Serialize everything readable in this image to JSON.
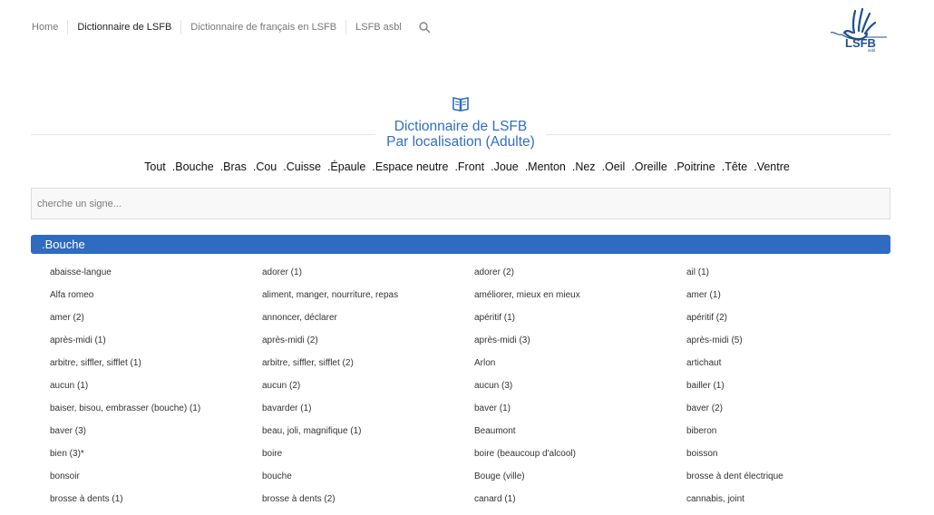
{
  "nav": {
    "items": [
      "Home",
      "Dictionnaire de LSFB",
      "Dictionnaire de français en LSFB",
      "LSFB asbl"
    ],
    "active_index": 1
  },
  "logo": {
    "text": "LSFB",
    "subtext": "asbl"
  },
  "title": {
    "line1": "Dictionnaire de LSFB",
    "line2": "Par localisation (Adulte)"
  },
  "filters": [
    "Tout",
    ".Bouche",
    ".Bras",
    ".Cou",
    ".Cuisse",
    ".Épaule",
    ".Espace neutre",
    ".Front",
    ".Joue",
    ".Menton",
    ".Nez",
    ".Oeil",
    ".Oreille",
    ".Poitrine",
    ".Tête",
    ".Ventre"
  ],
  "search": {
    "placeholder": "cherche un signe..."
  },
  "section": {
    "title": ".Bouche"
  },
  "words": [
    "abaisse-langue",
    "adorer (1)",
    "adorer (2)",
    "ail (1)",
    "Alfa romeo",
    "aliment, manger, nourriture, repas",
    "améliorer, mieux en mieux",
    "amer (1)",
    "amer (2)",
    "annoncer, déclarer",
    "apéritif (1)",
    "apéritif (2)",
    "après-midi (1)",
    "après-midi (2)",
    "après-midi (3)",
    "après-midi (5)",
    "arbitre, siffler, sifflet (1)",
    "arbitre, siffler, sifflet (2)",
    "Arlon",
    "artichaut",
    "aucun (1)",
    "aucun (2)",
    "aucun (3)",
    "bailler (1)",
    "baiser, bisou, embrasser (bouche) (1)",
    "bavarder (1)",
    "baver (1)",
    "baver (2)",
    "baver (3)",
    "beau, joli, magnifique (1)",
    "Beaumont",
    "biberon",
    "bien (3)*",
    "boire",
    "boire (beaucoup d'alcool)",
    "boisson",
    "bonsoir",
    "bouche",
    "Bouge (ville)",
    "brosse à dent électrique",
    "brosse à dents (1)",
    "brosse à dents (2)",
    "canard (1)",
    "cannabis, joint"
  ],
  "colors": {
    "accent": "#2f6bc0",
    "title": "#2f6fc4",
    "logo": "#1f4f8f"
  }
}
